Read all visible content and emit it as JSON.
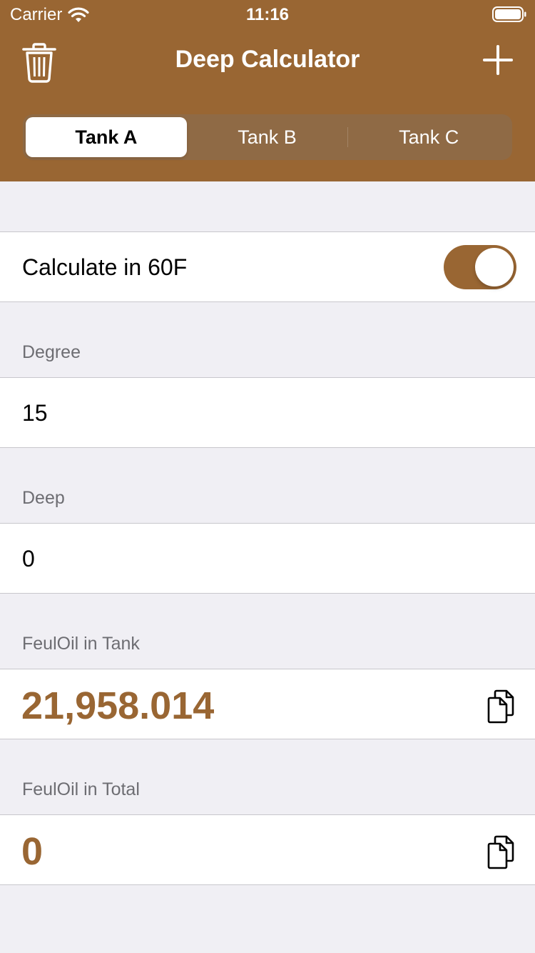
{
  "status_bar": {
    "carrier": "Carrier",
    "time": "11:16"
  },
  "nav": {
    "title": "Deep Calculator",
    "left_icon": "trash-icon",
    "right_icon": "plus-icon"
  },
  "tabs": [
    {
      "label": "Tank A",
      "selected": true
    },
    {
      "label": "Tank B",
      "selected": false
    },
    {
      "label": "Tank C",
      "selected": false
    }
  ],
  "settings": {
    "calc_60f_label": "Calculate in 60F",
    "calc_60f_on": true
  },
  "degree": {
    "header": "Degree",
    "value": "15"
  },
  "deep": {
    "header": "Deep",
    "value": "0"
  },
  "feuloil_tank": {
    "header": "FeulOil in Tank",
    "value": "21,958.014"
  },
  "feuloil_total": {
    "header": "FeulOil in Total",
    "value": "0"
  },
  "colors": {
    "accent": "#996633",
    "background": "#f0eff4",
    "secondary_text": "#6d6d72"
  }
}
